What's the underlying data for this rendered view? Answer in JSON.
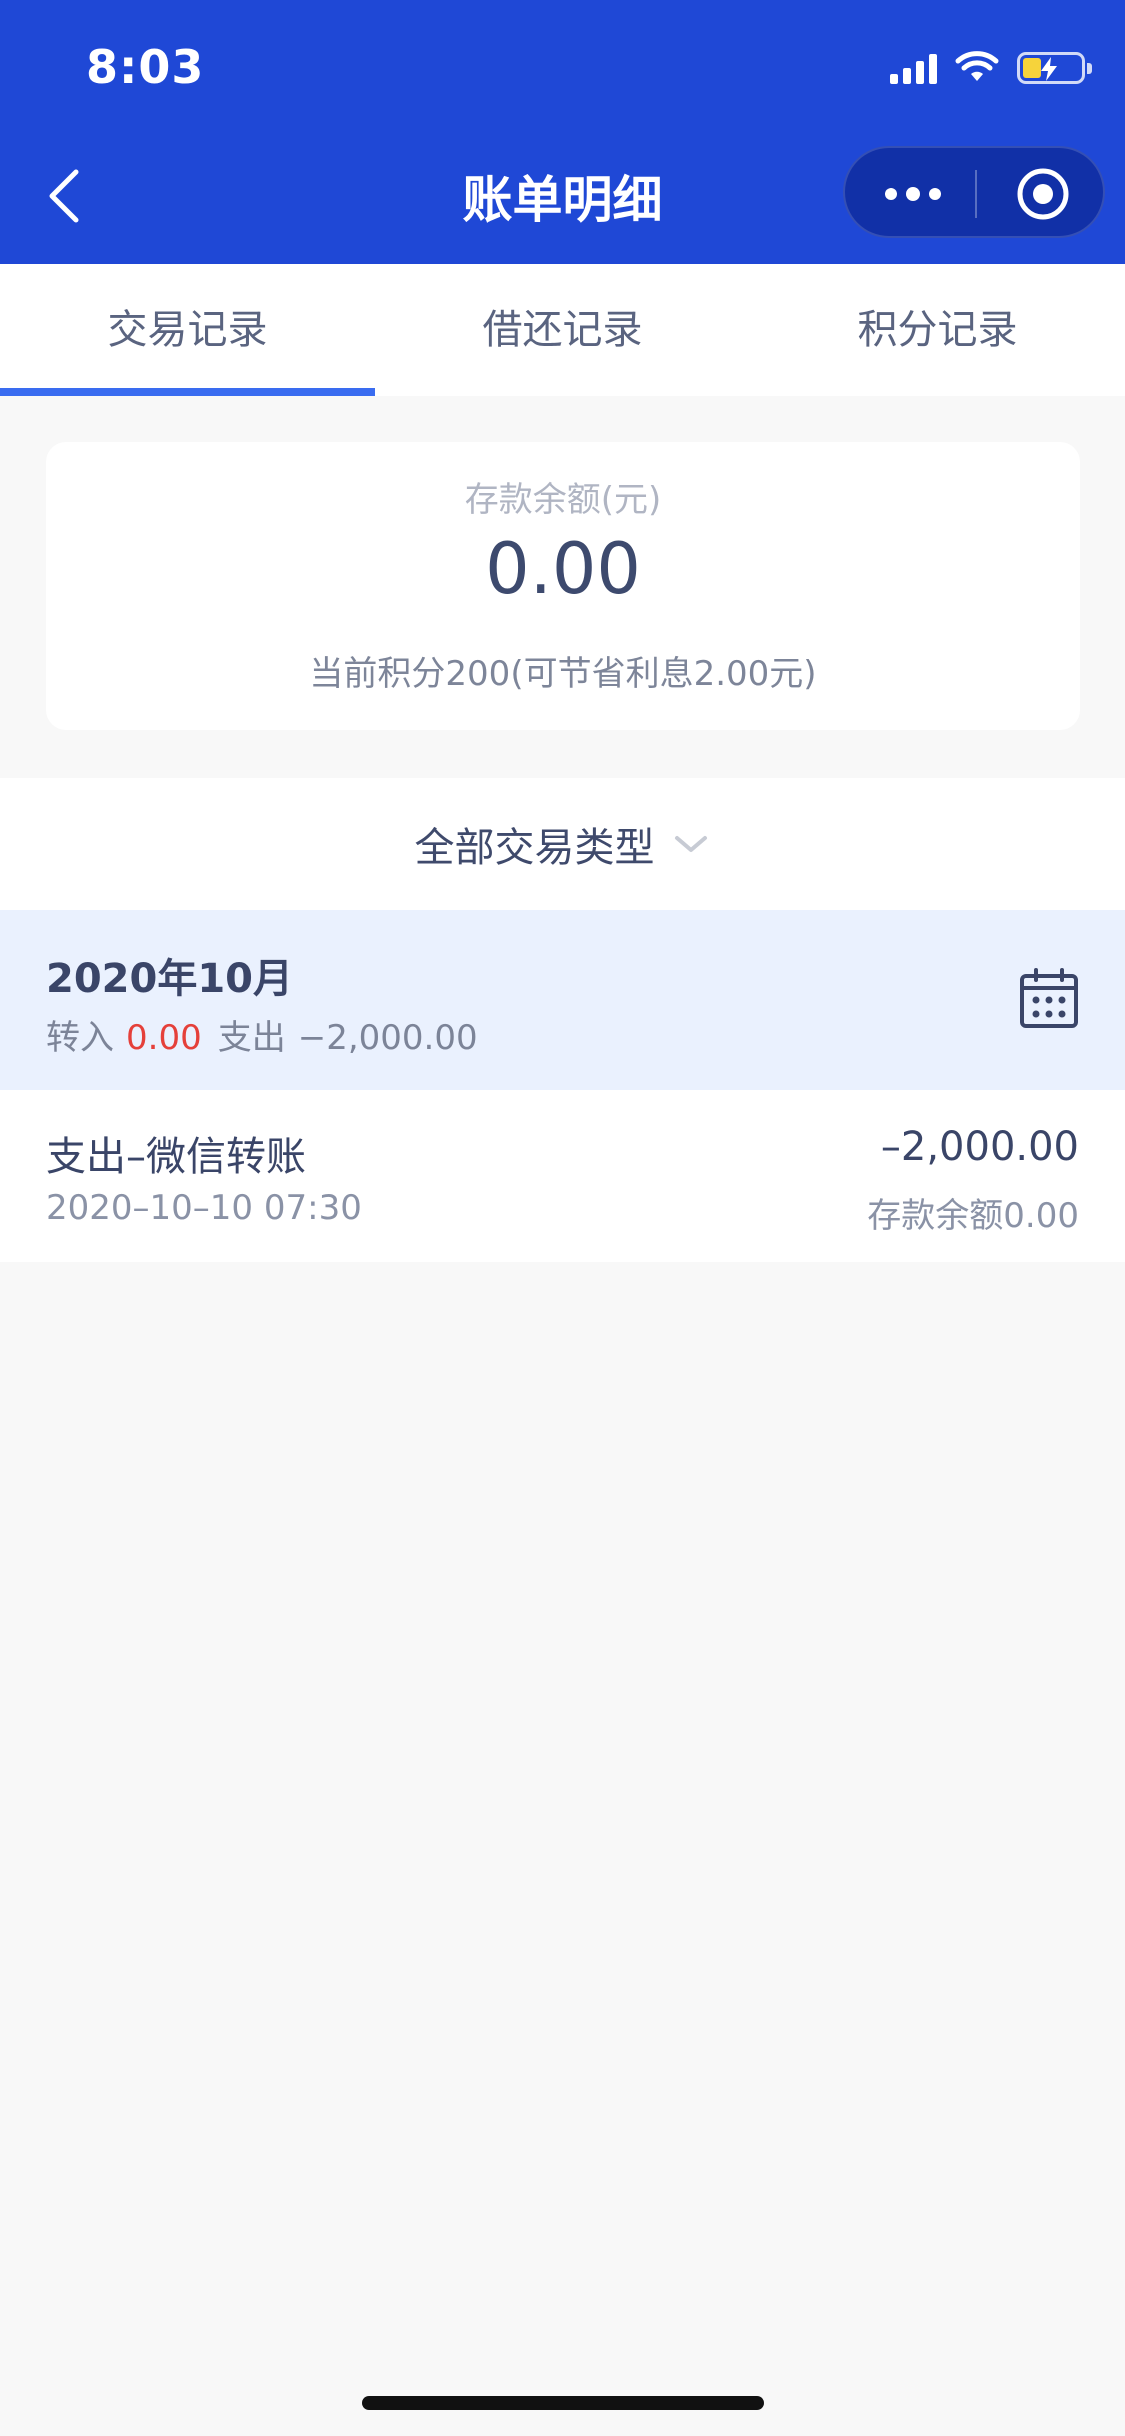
{
  "status_bar": {
    "time": "8:03"
  },
  "header": {
    "title": "账单明细"
  },
  "tabs": [
    {
      "label": "交易记录",
      "active": true
    },
    {
      "label": "借还记录",
      "active": false
    },
    {
      "label": "积分记录",
      "active": false
    }
  ],
  "balance": {
    "label": "存款余额(元)",
    "amount": "0.00",
    "points_text": "当前积分200(可节省利息2.00元)"
  },
  "filter": {
    "label": "全部交易类型"
  },
  "month": {
    "title": "2020年10月",
    "income_label": "转入",
    "income_value": "0.00",
    "expense_label": "支出",
    "expense_value": "−2,000.00"
  },
  "transactions": [
    {
      "title": "支出–微信转账",
      "datetime": "2020–10–10 07:30",
      "amount": "–2,000.00",
      "balance_after": "存款余额0.00"
    }
  ],
  "colors": {
    "header_bg": "#1f48d6",
    "tab_indicator": "#3a6cf0",
    "income_red": "#e5403a",
    "month_bg": "#eaf1fe"
  }
}
